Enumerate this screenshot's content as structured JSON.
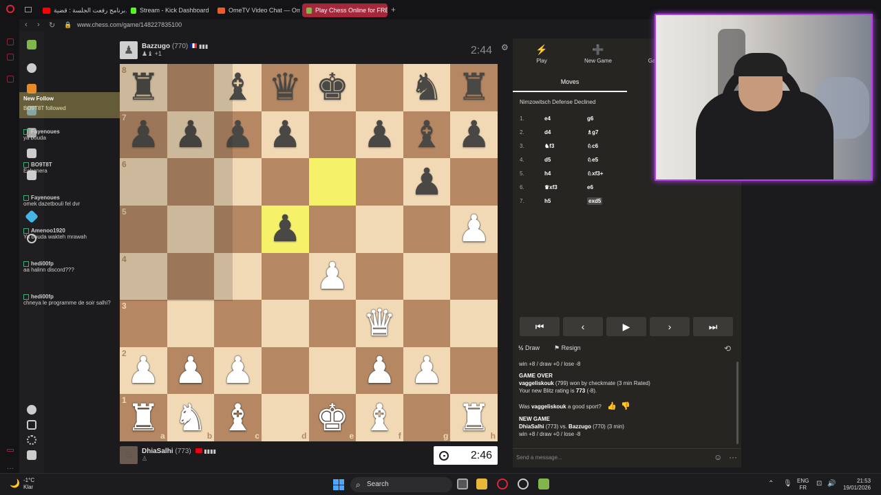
{
  "browser": {
    "tabs": [
      {
        "label": "برنامج رفعت الجلسة : قضية...",
        "color": "#ff0000"
      },
      {
        "label": "Stream - Kick Dashboard",
        "color": "#53fc18"
      },
      {
        "label": "OmeTV Video Chat — Om...",
        "color": "#e85d2b"
      },
      {
        "label": "Play Chess Online for FRE...",
        "color": "#81b64c"
      }
    ],
    "new_tab": "+",
    "url": "www.chess.com/game/148227835100"
  },
  "chat": {
    "follow_title": "New Follow",
    "follow_text": "BO9T8T followed",
    "messages": [
      {
        "user": "Fayenoues",
        "text": "ya bouda"
      },
      {
        "user": "BO9T8T",
        "text": "Eabanera"
      },
      {
        "user": "Fayenoues",
        "text": "omek dazetbouli fel dvr"
      },
      {
        "user": "Amenoo1920",
        "text": "Ya bouda wakteh mrawah"
      },
      {
        "user": "hedi00fp",
        "text": "aa halinn discord???"
      },
      {
        "user": "hedi00fp",
        "text": "chneya le programme de soir salhi?"
      }
    ]
  },
  "board": {
    "ranks": [
      "8",
      "7",
      "6",
      "5",
      "4",
      "3",
      "2",
      "1"
    ],
    "files": [
      "a",
      "b",
      "c",
      "d",
      "e",
      "f",
      "g",
      "h"
    ],
    "position": [
      [
        "bR",
        "",
        "bB",
        "bQ",
        "bK",
        "",
        "bN",
        "bR"
      ],
      [
        "bP",
        "bP",
        "bP",
        "bP",
        "",
        "bP",
        "bB",
        "bP"
      ],
      [
        "",
        "",
        "",
        "",
        "",
        "",
        "bP",
        ""
      ],
      [
        "",
        "",
        "",
        "bP",
        "",
        "",
        "",
        "wP"
      ],
      [
        "",
        "",
        "",
        "",
        "wP",
        "",
        "",
        ""
      ],
      [
        "",
        "",
        "",
        "",
        "",
        "wQ",
        "",
        ""
      ],
      [
        "wP",
        "wP",
        "wP",
        "",
        "",
        "wP",
        "wP",
        ""
      ],
      [
        "wR",
        "wN",
        "wB",
        "",
        "wK",
        "wB",
        "",
        "wR"
      ]
    ],
    "highlights": [
      "e6",
      "d5"
    ]
  },
  "players": {
    "top": {
      "name": "Bazzugo",
      "rating": "(770)",
      "material": "+1",
      "clock": "2:44"
    },
    "bottom": {
      "name": "DhiaSalhi",
      "rating": "(773)",
      "clock": "2:46"
    }
  },
  "panel": {
    "tabs": [
      {
        "label": "Play",
        "icon": "⚡"
      },
      {
        "label": "New Game",
        "icon": "➕"
      },
      {
        "label": "Ga",
        "icon": ""
      }
    ],
    "moves_tab": "Moves",
    "opening": "Nimzowitsch Defense Declined",
    "moves": [
      {
        "no": "1.",
        "w": "e4",
        "b": "g6"
      },
      {
        "no": "2.",
        "w": "d4",
        "b": "♗g7"
      },
      {
        "no": "3.",
        "w": "♞f3",
        "b": "♘c6"
      },
      {
        "no": "4.",
        "w": "d5",
        "b": "♘e5"
      },
      {
        "no": "5.",
        "w": "h4",
        "b": "♘xf3+"
      },
      {
        "no": "6.",
        "w": "♛xf3",
        "b": "e6"
      },
      {
        "no": "7.",
        "w": "h5",
        "b": "exd5"
      }
    ],
    "draw": "Draw",
    "draw_icon": "½",
    "resign": "Resign",
    "log": {
      "line1": "win +8 / draw +0 / lose -8",
      "game_over": "GAME OVER",
      "winner": "vaggeliskouk",
      "win_text": "(799) won by checkmate (3 min Rated)",
      "rating_text": "Your new Blitz rating is",
      "rating_value": "773",
      "rating_delta": "(-8).",
      "sport_q_prefix": "Was",
      "sport_q_name": "vaggeliskouk",
      "sport_q_suffix": "a good sport?",
      "new_game": "NEW GAME",
      "ng_p1": "DhiaSalhi",
      "ng_mid": "(773) vs.",
      "ng_p2": "Bazzugo",
      "ng_end": "(770) (3 min)",
      "line_last": "win +8 / draw +0 / lose -8"
    },
    "message_placeholder": "Send a message..."
  },
  "taskbar": {
    "temp": "-1°C",
    "weather": "Klar",
    "search": "Search",
    "lang1": "ENG",
    "lang2": "FR",
    "time": "21:53",
    "date": "19/01/2026"
  },
  "colors": {
    "accent": "#81b64c",
    "highlight": "#f5f26a",
    "webcam_border": "#b640f0"
  }
}
